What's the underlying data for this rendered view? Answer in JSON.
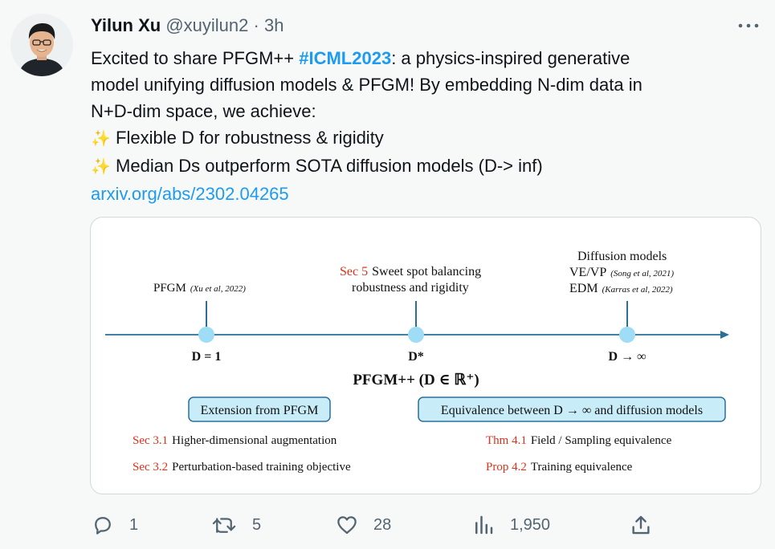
{
  "tweet": {
    "author_name": "Yilun Xu",
    "handle": "@xuyilun2",
    "separator": "·",
    "time": "3h",
    "more_icon": "more-icon",
    "text": {
      "l1_pre": "Excited to share PFGM++ ",
      "hashtag": "#ICML2023",
      "l1_post": ": a physics-inspired generative",
      "l2": "model unifying diffusion models & PFGM! By embedding N-dim data in",
      "l3": "N+D-dim space, we achieve:",
      "b1_icon": "✨",
      "b1": " Flexible D for robustness & rigidity",
      "b2_icon": "✨",
      "b2": " Median Ds outperform SOTA diffusion models (D-> inf)",
      "link": "arxiv.org/abs/2302.04265"
    }
  },
  "figure": {
    "pfgm_label": "PFGM",
    "pfgm_cite": "(Xu et al, 2022)",
    "sec5": "Sec 5",
    "sweet1": "Sweet spot balancing",
    "sweet2": "robustness and rigidity",
    "diff_title": "Diffusion models",
    "vevp": "VE/VP",
    "vevp_cite": "(Song et al, 2021)",
    "edm": "EDM",
    "edm_cite": "(Karras et al, 2022)",
    "d1": "D = 1",
    "dstar": "D*",
    "dinf": "D → ∞",
    "main_title": "PFGM++ (D ∈ ℝ⁺)",
    "box_left": "Extension from PFGM",
    "box_right": "Equivalence between D → ∞ and diffusion models",
    "sec31": "Sec 3.1",
    "sec31_text": "Higher-dimensional augmentation",
    "sec32": "Sec 3.2",
    "sec32_text": "Perturbation-based training objective",
    "thm41": "Thm 4.1",
    "thm41_text": "Field / Sampling equivalence",
    "prop42": "Prop 4.2",
    "prop42_text": "Training equivalence",
    "colors": {
      "axis": "#2a6e9a",
      "node": "#9fdcf5",
      "box": "#c8ecf8",
      "boxstroke": "#2a6e9a",
      "red": "#d9331c"
    }
  },
  "actions": {
    "reply_count": "1",
    "retweet_count": "5",
    "like_count": "28",
    "views_count": "1,950"
  }
}
